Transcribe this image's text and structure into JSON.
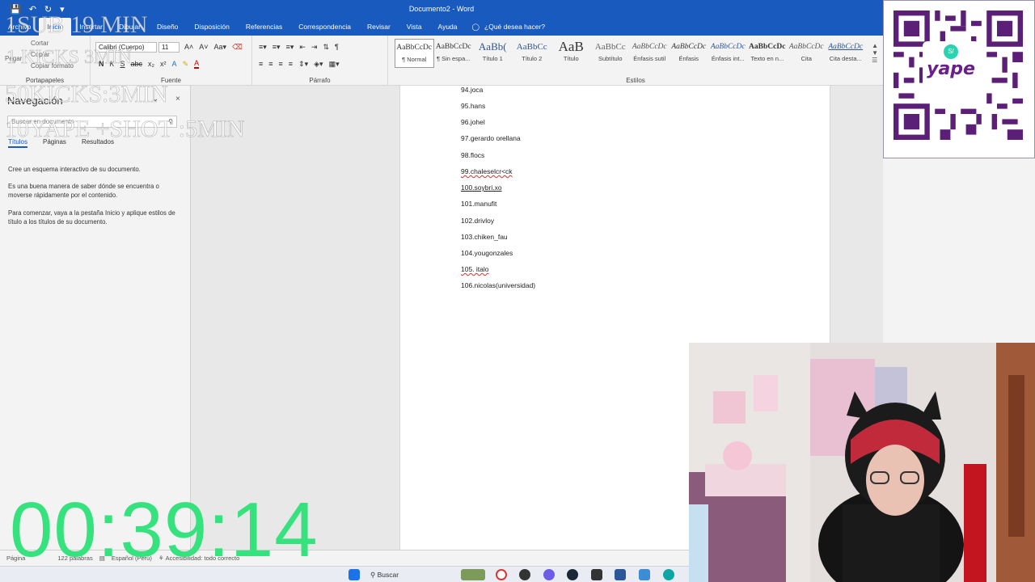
{
  "app": {
    "title": "Documento2 - Word",
    "quick_access": [
      "save-icon",
      "undo-icon",
      "redo-icon",
      "customize-icon"
    ]
  },
  "menu": {
    "tabs": [
      "Archivo",
      "Inicio",
      "Insertar",
      "Dibujar",
      "Diseño",
      "Disposición",
      "Referencias",
      "Correspondencia",
      "Revisar",
      "Vista",
      "Ayuda"
    ],
    "active_tab": "Inicio",
    "tell_me": "¿Qué desea hacer?"
  },
  "ribbon": {
    "clipboard": {
      "paste": "Pegar",
      "cut": "Cortar",
      "copy": "Copiar",
      "format_painter": "Copiar formato",
      "label": "Portapapeles"
    },
    "font": {
      "name": "Calibri (Cuerpo)",
      "size": "11",
      "label": "Fuente"
    },
    "paragraph": {
      "label": "Párrafo"
    },
    "styles": {
      "label": "Estilos",
      "items": [
        {
          "sample": "AaBbCcDc",
          "name": "¶ Normal"
        },
        {
          "sample": "AaBbCcDc",
          "name": "¶ Sin espa..."
        },
        {
          "sample": "AaBb(",
          "name": "Título 1"
        },
        {
          "sample": "AaBbCc",
          "name": "Título 2"
        },
        {
          "sample": "AaB",
          "name": "Título"
        },
        {
          "sample": "AaBbCc",
          "name": "Subtítulo"
        },
        {
          "sample": "AaBbCcDc",
          "name": "Énfasis sutil"
        },
        {
          "sample": "AaBbCcDc",
          "name": "Énfasis"
        },
        {
          "sample": "AaBbCcDc",
          "name": "Énfasis int..."
        },
        {
          "sample": "AaBbCcDc",
          "name": "Texto en n..."
        },
        {
          "sample": "AaBbCcDc",
          "name": "Cita"
        },
        {
          "sample": "AaBbCcDc",
          "name": "Cita desta..."
        }
      ]
    }
  },
  "navigation": {
    "title": "Navegación",
    "search_placeholder": "Buscar en documento",
    "tabs": [
      "Títulos",
      "Páginas",
      "Resultados"
    ],
    "active_tab": "Títulos",
    "help": [
      "Cree un esquema interactivo de su documento.",
      "Es una buena manera de saber dónde se encuentra o moverse rápidamente por el contenido.",
      "Para comenzar, vaya a la pestaña Inicio y aplique estilos de título a los títulos de su documento."
    ]
  },
  "document": {
    "lines": [
      "94.joca",
      "95.hans",
      "96.johel",
      "97.gerardo orellana",
      "98.flocs",
      "99.chaleselcr<ck",
      "100.soybri.xo",
      "101.manufit",
      "102.drivloy",
      "103.chiken_fau",
      "104.yougonzales",
      "105. italo",
      "106.nicolas(universidad)"
    ]
  },
  "status": {
    "page": "Página",
    "words": "122 palabras",
    "language": "Español (Perú)",
    "accessibility": "Accesibilidad: todo correcto"
  },
  "taskbar": {
    "search": "Buscar"
  },
  "overlay": {
    "lines": [
      "1SUB 19 MIN",
      "1 KICKS 3MIN",
      "50KICKS:3MIN",
      "10YAPE +SHOT :5MIN"
    ],
    "timer": "00:39:14"
  },
  "qr": {
    "brand": "yape",
    "coin": "S/"
  }
}
